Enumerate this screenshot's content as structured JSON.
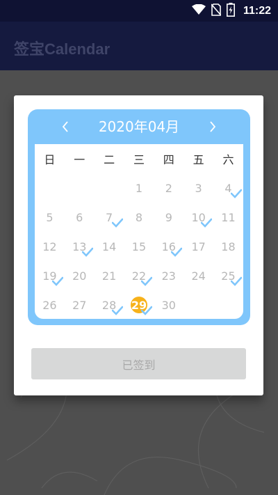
{
  "status_bar": {
    "time": "11:22",
    "icons": [
      "wifi-icon",
      "no-sim-icon",
      "battery-charging-icon"
    ]
  },
  "app_bar": {
    "title": "签宝Calendar"
  },
  "calendar": {
    "month_label": "2020年04月",
    "prev_icon": "chevron-left-icon",
    "next_icon": "chevron-right-icon",
    "weekdays": [
      "日",
      "一",
      "二",
      "三",
      "四",
      "五",
      "六"
    ],
    "days": [
      "1",
      "2",
      "3",
      "4",
      "5",
      "6",
      "7",
      "8",
      "9",
      "10",
      "11",
      "12",
      "13",
      "14",
      "15",
      "16",
      "17",
      "18",
      "19",
      "20",
      "21",
      "22",
      "23",
      "24",
      "25",
      "26",
      "27",
      "28",
      "29",
      "30"
    ],
    "first_weekday_index": 3,
    "today": "29",
    "checked_days": [
      "4",
      "7",
      "10",
      "13",
      "16",
      "19",
      "22",
      "25",
      "28",
      "29"
    ],
    "colors": {
      "frame": "#7fc6fb",
      "today": "#f7b21b",
      "check": "#7fc6fb",
      "day_text": "#b7b7b7"
    }
  },
  "action": {
    "signin_label": "已签到"
  }
}
